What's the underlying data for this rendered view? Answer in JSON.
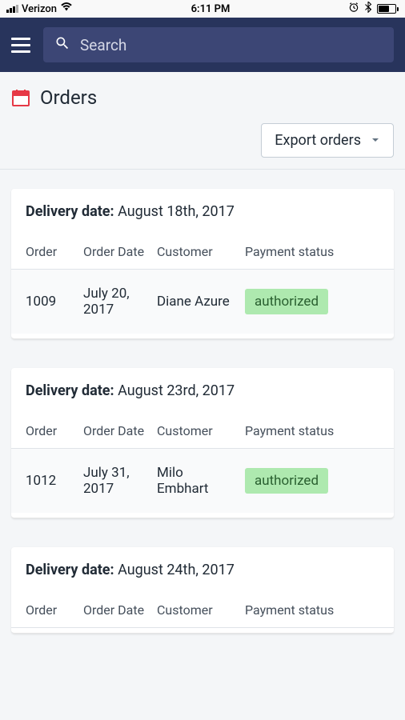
{
  "statusBar": {
    "carrier": "Verizon",
    "time": "6:11 PM"
  },
  "header": {
    "searchPlaceholder": "Search"
  },
  "page": {
    "title": "Orders",
    "exportLabel": "Export orders"
  },
  "columns": {
    "order": "Order",
    "orderDate": "Order Date",
    "customer": "Customer",
    "paymentStatus": "Payment status"
  },
  "labels": {
    "deliveryDate": "Delivery date:"
  },
  "groups": [
    {
      "deliveryDate": "August 18th, 2017",
      "row": {
        "order": "1009",
        "orderDate": "July 20, 2017",
        "customer": "Diane Azure",
        "status": "authorized"
      }
    },
    {
      "deliveryDate": "August 23rd, 2017",
      "row": {
        "order": "1012",
        "orderDate": "July 31, 2017",
        "customer": "Milo Embhart",
        "status": "authorized"
      }
    },
    {
      "deliveryDate": "August 24th, 2017",
      "row": {
        "order": "",
        "orderDate": "",
        "customer": "",
        "status": ""
      }
    }
  ]
}
